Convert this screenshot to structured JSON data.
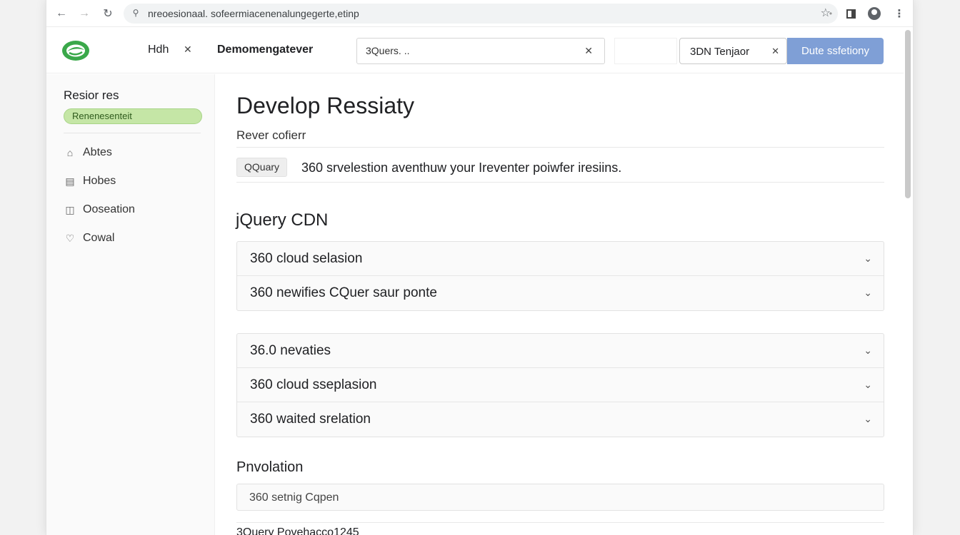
{
  "browser": {
    "url": "nreoesionaal. sofeermiacenenalungegerte,etinp"
  },
  "appbar": {
    "tab1_label": "Hdh",
    "tab2_label": "Demomengatever",
    "search_value": "3Quers. ..",
    "chip_label": "3DN Tenjaor",
    "primary_button": "Dute ssfetiony",
    "logo_color": "#3aa84a"
  },
  "sidebar": {
    "title": "Resior res",
    "badge": "Renenesenteit",
    "items": [
      {
        "label": "Abtes",
        "icon": "home-icon"
      },
      {
        "label": "Hobes",
        "icon": "document-icon"
      },
      {
        "label": "Ooseation",
        "icon": "lock-icon"
      },
      {
        "label": "Cowal",
        "icon": "bell-icon"
      }
    ]
  },
  "main": {
    "title": "Develop Ressiaty",
    "subtitle": "Rever cofierr",
    "tag": "QQuary",
    "tag_text": "360  srvelestion aventhuw your Ireventer poiwfer iresiins.",
    "section_title": "jQuery CDN",
    "group1": [
      "360 cloud selasion",
      "360 newifies CQuer saur ponte"
    ],
    "group2": [
      "36.0 nevaties",
      "360 cloud sseplasion",
      "360 waited srelation"
    ],
    "section2_title": "Pnvolation",
    "field_value": "360 setnig Cqpen",
    "footer_text": "3Query Povehacco1245"
  }
}
